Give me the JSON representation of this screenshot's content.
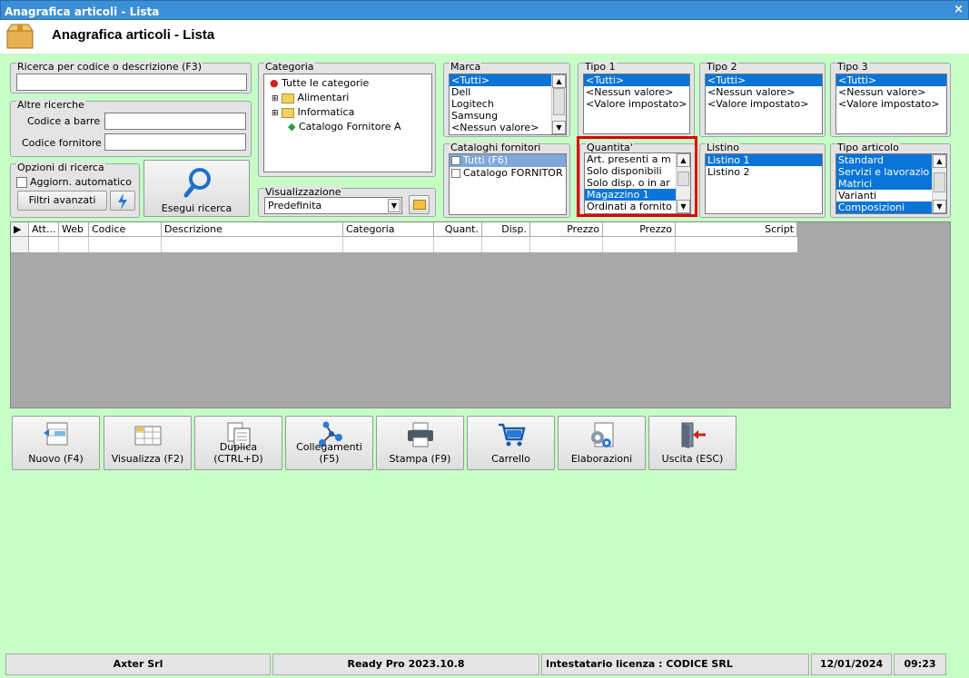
{
  "window": {
    "title": "Anagrafica articoli  - Lista",
    "close": "×"
  },
  "header": {
    "title": "Anagrafica articoli  - Lista"
  },
  "search": {
    "label": "Ricerca per codice o descrizione (F3)",
    "value": ""
  },
  "other": {
    "label": "Altre ricerche",
    "barcode_label": "Codice a barre :",
    "supplier_label": "Codice fornitore :"
  },
  "options": {
    "label": "Opzioni di ricerca",
    "auto_update": "Aggiorn. automatico",
    "advanced": "Filtri avanzati",
    "run_search": "Esegui ricerca"
  },
  "categoria": {
    "label": "Categoria",
    "root": "Tutte le categorie",
    "items": [
      "Alimentari",
      "Informatica",
      "Catalogo Fornitore A"
    ]
  },
  "visualizzazione": {
    "label": "Visualizzazione",
    "value": "Predefinita"
  },
  "marca": {
    "label": "Marca",
    "items": [
      "<Tutti>",
      "Dell",
      "Logitech",
      "Samsung",
      "<Nessun valore>"
    ]
  },
  "tipo1": {
    "label": "Tipo 1",
    "items": [
      "<Tutti>",
      "<Nessun valore>",
      "<Valore impostato>"
    ]
  },
  "tipo2": {
    "label": "Tipo 2",
    "items": [
      "<Tutti>",
      "<Nessun valore>",
      "<Valore impostato>"
    ]
  },
  "tipo3": {
    "label": "Tipo 3",
    "items": [
      "<Tutti>",
      "<Nessun valore>",
      "<Valore impostato>"
    ]
  },
  "cataloghi": {
    "label": "Cataloghi fornitori",
    "items": [
      "Tutti (F6)",
      "Catalogo FORNITOR"
    ]
  },
  "quantita": {
    "label": "Quantita'",
    "items": [
      "Art. presenti a m",
      "Solo disponibili",
      "Solo disp. o in ar",
      "Magazzino 1",
      "Ordinati a fornito"
    ]
  },
  "listino": {
    "label": "Listino",
    "items": [
      "Listino 1",
      "Listino 2"
    ]
  },
  "tipo_articolo": {
    "label": "Tipo articolo",
    "items": [
      "Standard",
      "Servizi e lavorazio",
      "Matrici",
      "Varianti",
      "Composizioni"
    ]
  },
  "table": {
    "columns": [
      "Att...",
      "Web",
      "Codice",
      "Descrizione",
      "Categoria",
      "Quant.",
      "Disp.",
      "Prezzo",
      "Prezzo",
      "Script"
    ]
  },
  "toolbar": {
    "buttons": [
      "Nuovo (F4)",
      "Visualizza (F2)",
      "Duplica (CTRL+D)",
      "Collegamenti (F5)",
      "Stampa (F9)",
      "Carrello",
      "Elaborazioni",
      "Uscita (ESC)"
    ]
  },
  "status": {
    "company": "Axter Srl",
    "version": "Ready Pro 2023.10.8",
    "license": "Intestatario licenza : CODICE SRL",
    "date": "12/01/2024",
    "time": "09:23"
  },
  "colors": {
    "titlebar": "#3b8fd6",
    "background": "#c6fec6",
    "selection": "#0a74d8",
    "highlight": "#e00000"
  }
}
